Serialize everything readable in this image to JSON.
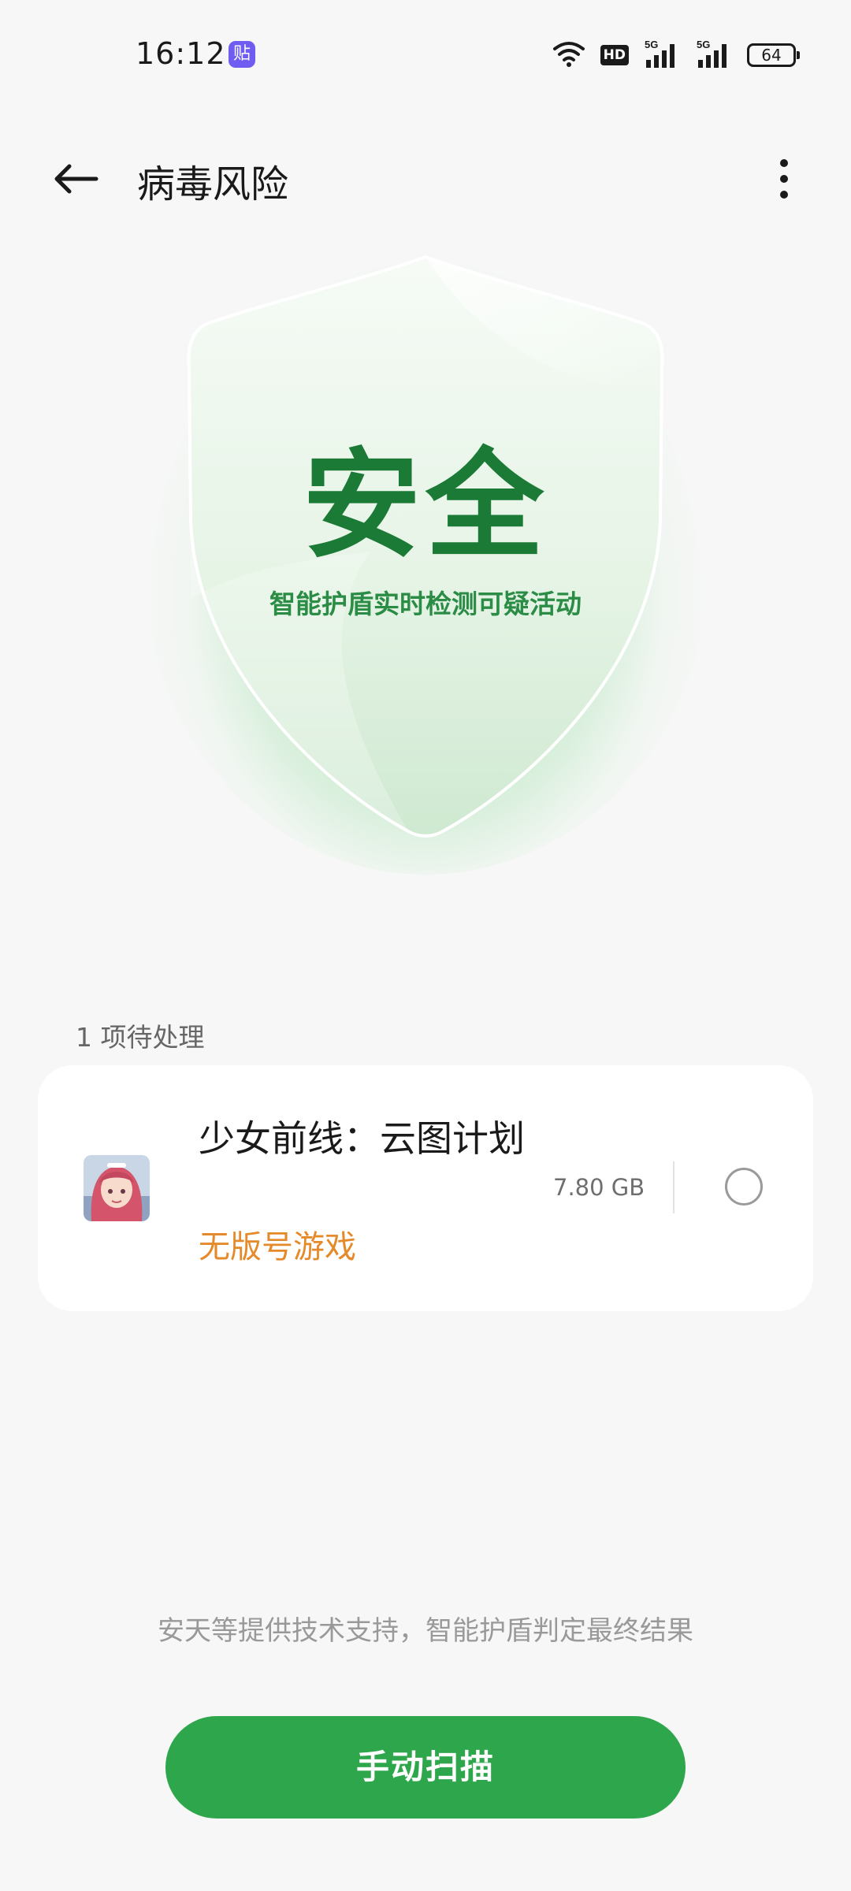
{
  "status_bar": {
    "time": "16:12",
    "notification_icon_text": "贴",
    "hd_label": "HD",
    "network_label_1": "5G",
    "network_label_2": "5G",
    "battery_level": "64",
    "icons": [
      "wifi-icon",
      "hd-voice-icon",
      "signal-icon",
      "signal-icon",
      "battery-icon"
    ]
  },
  "header": {
    "title": "病毒风险",
    "back_icon": "back-arrow-icon",
    "more_icon": "more-vertical-icon"
  },
  "hero": {
    "status": "安全",
    "subtitle": "智能护盾实时检测可疑活动",
    "colors": {
      "status_text": "#1a7a36",
      "glow": "#58c86e"
    }
  },
  "pending": {
    "label": "1 项待处理",
    "items": [
      {
        "name": "少女前线：云图计划",
        "tag": "无版号游戏",
        "size": "7.80 GB",
        "selected": false
      }
    ]
  },
  "footer": {
    "note": "安天等提供技术支持，智能护盾判定最终结果",
    "scan_button": "手动扫描",
    "button_color": "#2ea64b"
  }
}
